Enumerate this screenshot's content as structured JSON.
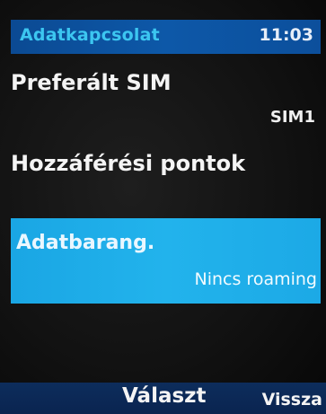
{
  "status_bar": {
    "title": "Adatkapcsolat",
    "clock": "11:03",
    "background_color": "#0c4f9c",
    "title_color": "#3cc6f0"
  },
  "menu": {
    "items": [
      {
        "label": "Preferált SIM",
        "value": "SIM1"
      },
      {
        "label": "Hozzáférési pontok"
      },
      {
        "label": "Adatbarang.",
        "value": "Nincs roaming",
        "selected": true
      }
    ],
    "highlight_color": "#1ea9e6"
  },
  "softkeys": {
    "center": "Választ",
    "right": "Vissza",
    "background_color": "#0b2754"
  }
}
